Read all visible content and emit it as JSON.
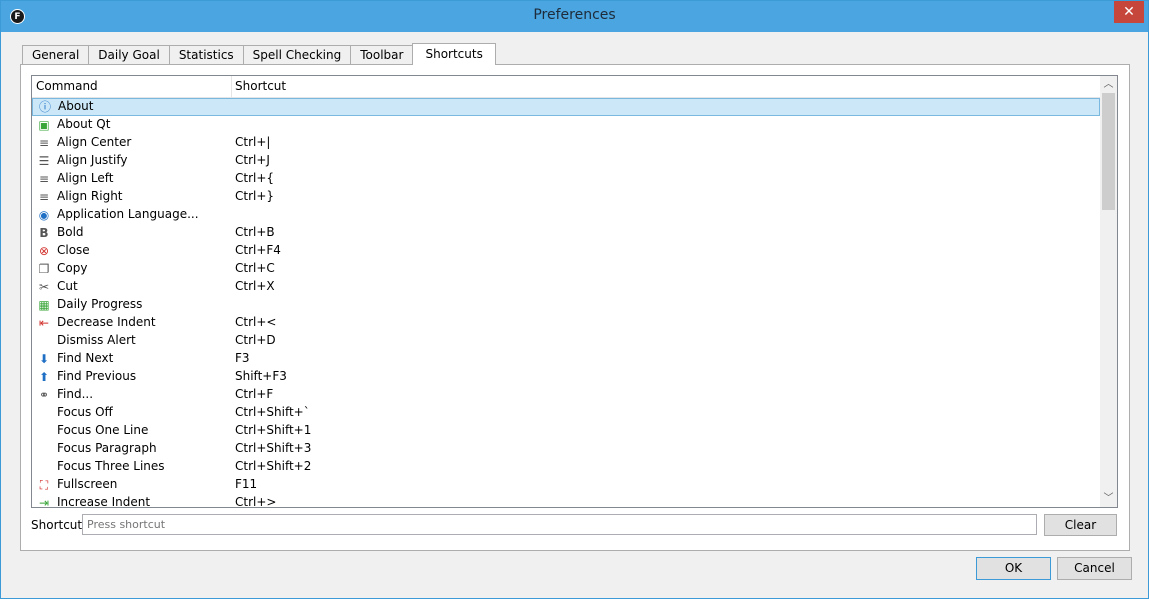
{
  "window": {
    "title": "Preferences",
    "app_icon_letter": "F",
    "close_glyph": "✕"
  },
  "tabs": [
    {
      "label": "General"
    },
    {
      "label": "Daily Goal"
    },
    {
      "label": "Statistics"
    },
    {
      "label": "Spell Checking"
    },
    {
      "label": "Toolbar"
    },
    {
      "label": "Shortcuts",
      "active": true
    }
  ],
  "table": {
    "headers": {
      "command": "Command",
      "shortcut": "Shortcut"
    },
    "rows": [
      {
        "icon": "info-icon",
        "command": "About",
        "shortcut": "",
        "selected": true
      },
      {
        "icon": "qt-icon",
        "command": "About Qt",
        "shortcut": ""
      },
      {
        "icon": "align-center-icon",
        "command": "Align Center",
        "shortcut": "Ctrl+|"
      },
      {
        "icon": "align-justify-icon",
        "command": "Align Justify",
        "shortcut": "Ctrl+J"
      },
      {
        "icon": "align-left-icon",
        "command": "Align Left",
        "shortcut": "Ctrl+{"
      },
      {
        "icon": "align-right-icon",
        "command": "Align Right",
        "shortcut": "Ctrl+}"
      },
      {
        "icon": "language-icon",
        "command": "Application Language...",
        "shortcut": ""
      },
      {
        "icon": "bold-icon",
        "command": "Bold",
        "shortcut": "Ctrl+B"
      },
      {
        "icon": "close-circle-icon",
        "command": "Close",
        "shortcut": "Ctrl+F4"
      },
      {
        "icon": "copy-icon",
        "command": "Copy",
        "shortcut": "Ctrl+C"
      },
      {
        "icon": "cut-icon",
        "command": "Cut",
        "shortcut": "Ctrl+X"
      },
      {
        "icon": "calendar-icon",
        "command": "Daily Progress",
        "shortcut": ""
      },
      {
        "icon": "decrease-indent-icon",
        "command": "Decrease Indent",
        "shortcut": "Ctrl+<"
      },
      {
        "icon": "",
        "command": "Dismiss Alert",
        "shortcut": "Ctrl+D"
      },
      {
        "icon": "arrow-down-icon",
        "command": "Find Next",
        "shortcut": "F3"
      },
      {
        "icon": "arrow-up-icon",
        "command": "Find Previous",
        "shortcut": "Shift+F3"
      },
      {
        "icon": "binoculars-icon",
        "command": "Find...",
        "shortcut": "Ctrl+F"
      },
      {
        "icon": "",
        "command": "Focus Off",
        "shortcut": "Ctrl+Shift+`"
      },
      {
        "icon": "",
        "command": "Focus One Line",
        "shortcut": "Ctrl+Shift+1"
      },
      {
        "icon": "",
        "command": "Focus Paragraph",
        "shortcut": "Ctrl+Shift+3"
      },
      {
        "icon": "",
        "command": "Focus Three Lines",
        "shortcut": "Ctrl+Shift+2"
      },
      {
        "icon": "fullscreen-icon",
        "command": "Fullscreen",
        "shortcut": "F11"
      },
      {
        "icon": "increase-indent-icon",
        "command": "Increase Indent",
        "shortcut": "Ctrl+>"
      }
    ]
  },
  "shortcut_field": {
    "label": "Shortcut:",
    "placeholder": "Press shortcut",
    "clear_label": "Clear"
  },
  "buttons": {
    "ok": "OK",
    "cancel": "Cancel"
  }
}
